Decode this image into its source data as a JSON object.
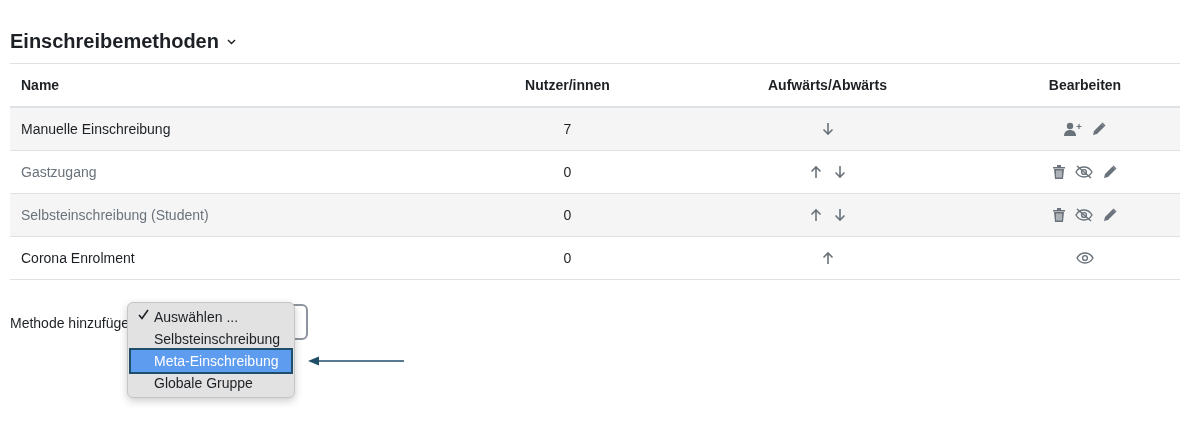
{
  "heading": {
    "title": "Einschreibemethoden",
    "expandable": true
  },
  "table": {
    "columns": [
      "Name",
      "Nutzer/innen",
      "Aufwärts/Abwärts",
      "Bearbeiten"
    ],
    "rows": [
      {
        "name": "Manuelle Einschreibung",
        "disabled": false,
        "users": "7",
        "can_move_up": false,
        "can_move_down": true,
        "actions": [
          {
            "kind": "enrol"
          },
          {
            "kind": "edit"
          }
        ]
      },
      {
        "name": "Gastzugang",
        "disabled": true,
        "users": "0",
        "can_move_up": true,
        "can_move_down": true,
        "actions": [
          {
            "kind": "delete"
          },
          {
            "kind": "hide"
          },
          {
            "kind": "edit"
          }
        ]
      },
      {
        "name": "Selbsteinschreibung (Student)",
        "disabled": true,
        "users": "0",
        "can_move_up": true,
        "can_move_down": true,
        "actions": [
          {
            "kind": "delete"
          },
          {
            "kind": "hide"
          },
          {
            "kind": "edit"
          }
        ]
      },
      {
        "name": "Corona Enrolment",
        "disabled": false,
        "users": "0",
        "can_move_up": true,
        "can_move_down": false,
        "actions": [
          {
            "kind": "show"
          }
        ]
      }
    ]
  },
  "add_method": {
    "label": "Methode hinzufüge",
    "options": [
      {
        "label": "Auswählen ...",
        "checked": true,
        "selected": false
      },
      {
        "label": "Selbsteinschreibung",
        "checked": false,
        "selected": false
      },
      {
        "label": "Meta-Einschreibung",
        "checked": false,
        "selected": true
      },
      {
        "label": "Globale Gruppe",
        "checked": false,
        "selected": false
      }
    ]
  }
}
